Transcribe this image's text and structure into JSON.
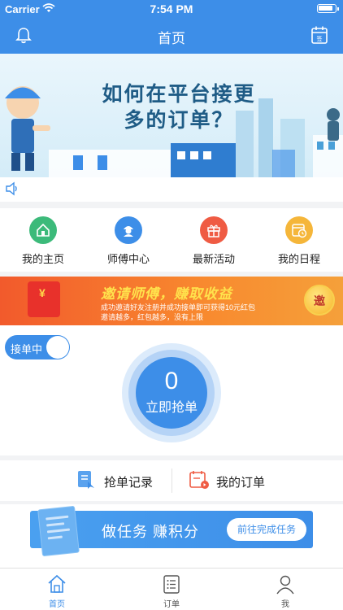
{
  "status_bar": {
    "carrier": "Carrier",
    "time": "7:54 PM"
  },
  "nav": {
    "title": "首页"
  },
  "banner": {
    "headline_line1": "如何在平台接更",
    "headline_line2": "多的订单？"
  },
  "shortcuts": [
    {
      "label": "我的主页",
      "color": "#3cba7a",
      "icon": "home-icon"
    },
    {
      "label": "师傅中心",
      "color": "#3d8ee8",
      "icon": "worker-icon"
    },
    {
      "label": "最新活动",
      "color": "#ef5b43",
      "icon": "gift-icon"
    },
    {
      "label": "我的日程",
      "color": "#f5b63a",
      "icon": "schedule-icon"
    }
  ],
  "promo": {
    "title": "邀请师傅，赚取收益",
    "line1": "成功邀请好友注册并成功接单即可获得10元红包",
    "line2": "邀请越多，红包越多，没有上限",
    "coin_label": "邀"
  },
  "grab": {
    "toggle_label": "接单中",
    "count": "0",
    "button_label": "立即抢单"
  },
  "orders": {
    "grab_records": "抢单记录",
    "my_orders": "我的订单"
  },
  "task": {
    "text": "做任务 赚积分",
    "button": "前往完成任务"
  },
  "tabs": [
    {
      "label": "首页",
      "active": true
    },
    {
      "label": "订单",
      "active": false
    },
    {
      "label": "我",
      "active": false
    }
  ],
  "colors": {
    "primary": "#3d8ee8",
    "promo_orange": "#f25a2c"
  }
}
